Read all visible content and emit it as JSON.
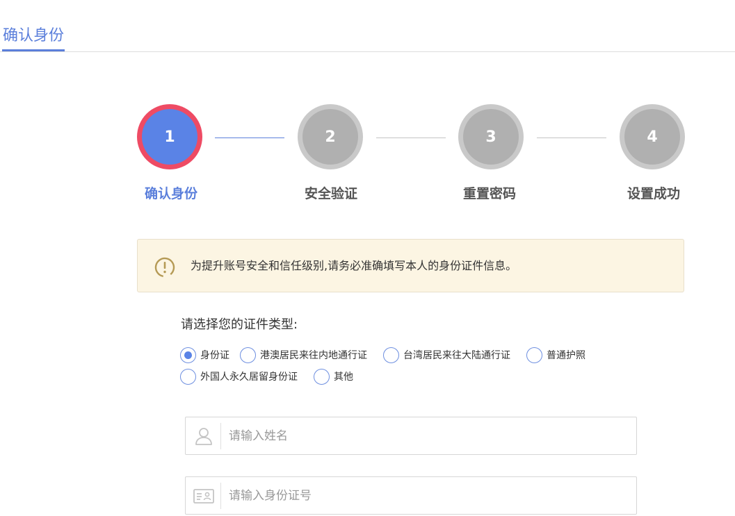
{
  "tab": {
    "label": "确认身份"
  },
  "steps": [
    {
      "number": "1",
      "label": "确认身份",
      "active": true
    },
    {
      "number": "2",
      "label": "安全验证",
      "active": false
    },
    {
      "number": "3",
      "label": "重置密码",
      "active": false
    },
    {
      "number": "4",
      "label": "设置成功",
      "active": false
    }
  ],
  "notice": {
    "icon": "warning-circle-icon",
    "text": "为提升账号安全和信任级别,请务必准确填写本人的身份证件信息。"
  },
  "id_type": {
    "prompt": "请选择您的证件类型:",
    "selected": "身份证",
    "options": [
      {
        "label": "身份证"
      },
      {
        "label": "港澳居民来往内地通行证"
      },
      {
        "label": "台湾居民来往大陆通行证"
      },
      {
        "label": "普通护照"
      },
      {
        "label": "外国人永久居留身份证"
      },
      {
        "label": "其他"
      }
    ]
  },
  "name_field": {
    "placeholder": "请输入姓名",
    "value": "",
    "icon": "user-icon"
  },
  "id_field": {
    "placeholder": "请输入身份证号",
    "value": "",
    "icon": "id-card-icon"
  },
  "colors": {
    "accent": "#5b7fdb",
    "active_ring": "#ee4b64",
    "inactive_step": "#b0b0b0",
    "notice_bg": "#fcf5e3"
  }
}
